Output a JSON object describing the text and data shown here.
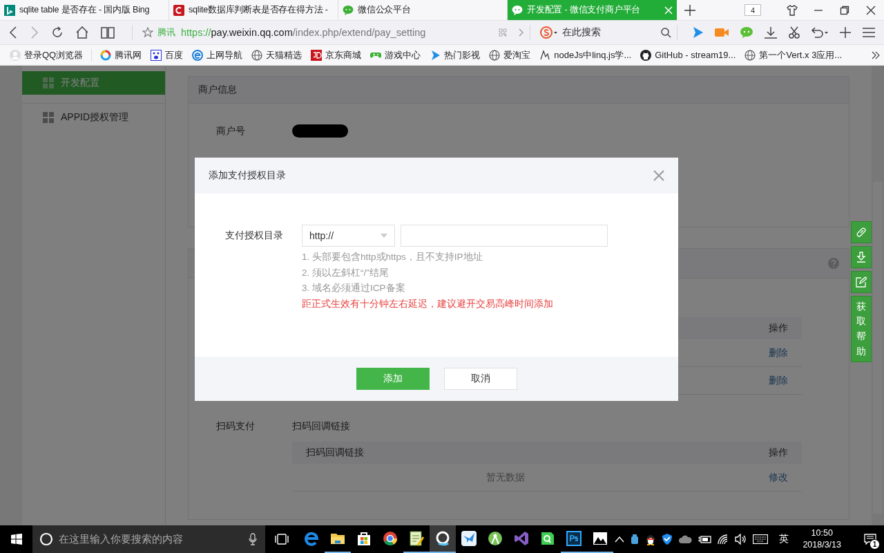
{
  "browser": {
    "tabs": [
      {
        "title": "sqlite table 是否存在 - 国内版 Bing",
        "selected": false
      },
      {
        "title": "sqlite数据库判断表是否存在得方法 -",
        "selected": false
      },
      {
        "title": "微信公众平台",
        "selected": false
      },
      {
        "title": "开发配置 - 微信支付商户平台",
        "selected": true
      }
    ],
    "tab_count": "4",
    "address": {
      "site_label": "腾讯",
      "url": {
        "scheme": "https://",
        "host": "pay.weixin.qq.com",
        "path": "/index.php/extend/pay_setting"
      }
    },
    "search": {
      "placeholder": "在此搜索"
    },
    "bookmarks": [
      "登录QQ浏览器",
      "腾讯网",
      "百度",
      "上网导航",
      "天猫精选",
      "京东商城",
      "游戏中心",
      "热门影视",
      "爱淘宝",
      "nodeJs中linq.js学...",
      "GitHub - stream19...",
      "第一个Vert.x 3应用..."
    ]
  },
  "sidebar": {
    "items": [
      {
        "label": "开发配置",
        "selected": true
      },
      {
        "label": "APPID授权管理",
        "selected": false
      }
    ]
  },
  "merchant_panel": {
    "title": "商户信息",
    "fields": [
      {
        "label": "商户号"
      }
    ]
  },
  "payment_panel": {
    "table": {
      "action_column": "操作",
      "rows": [
        {
          "action": "删除"
        },
        {
          "action": "删除"
        }
      ]
    },
    "scan_section": {
      "label": "扫码支付",
      "caption": "扫码回调链接",
      "table": {
        "title_column": "扫码回调链接",
        "action_column": "操作",
        "rows": [
          {
            "text": "暂无数据",
            "action": "修改"
          }
        ]
      }
    }
  },
  "help_bar": {
    "help_label": "获取帮助"
  },
  "dialog": {
    "title": "添加支付授权目录",
    "field_label": "支付授权目录",
    "protocol": "http://",
    "hints": [
      "1. 头部要包含http或https，且不支持IP地址",
      "2. 须以左斜杠“/”结尾",
      "3. 域名必须通过ICP备案"
    ],
    "warning": "距正式生效有十分钟左右延迟，建议避开交易高峰时间添加",
    "buttons": [
      {
        "label": "添加",
        "kind": "primary"
      },
      {
        "label": "取消",
        "kind": "secondary"
      }
    ]
  },
  "taskbar": {
    "search": {
      "placeholder": "在这里输入你要搜索的内容"
    },
    "apps": [
      {
        "running": false,
        "selected": false
      },
      {
        "running": true,
        "selected": false
      },
      {
        "running": false,
        "selected": false
      },
      {
        "running": false,
        "selected": false
      },
      {
        "running": true,
        "selected": false
      },
      {
        "running": true,
        "selected": true
      },
      {
        "running": false,
        "selected": false
      },
      {
        "running": false,
        "selected": false
      },
      {
        "running": false,
        "selected": false
      },
      {
        "running": false,
        "selected": false
      },
      {
        "running": true,
        "selected": false
      },
      {
        "running": true,
        "selected": false
      }
    ],
    "language": "英",
    "time": "10:50",
    "date": "2018/3/13",
    "notification_count": "1"
  }
}
